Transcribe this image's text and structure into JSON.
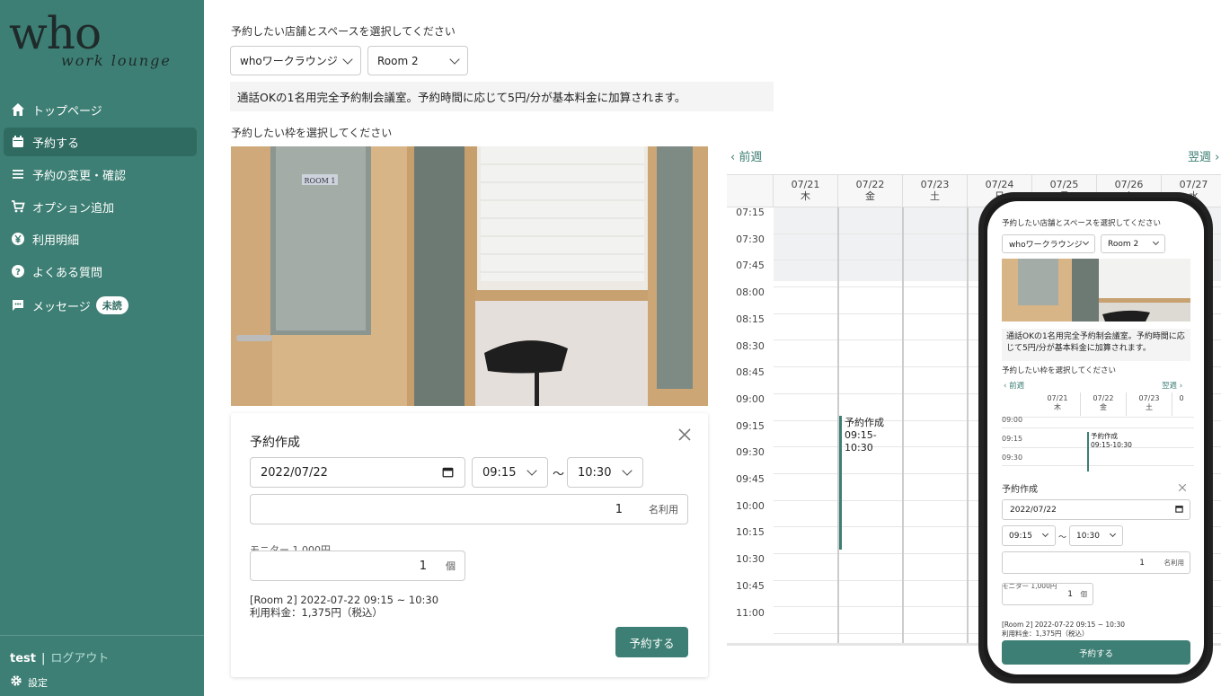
{
  "sidebar": {
    "logo_main": "who",
    "logo_sub": "work lounge",
    "items": [
      {
        "label": "トップページ",
        "icon": "home-icon"
      },
      {
        "label": "予約する",
        "icon": "calendar-icon",
        "active": true
      },
      {
        "label": "予約の変更・確認",
        "icon": "list-icon"
      },
      {
        "label": "オプション追加",
        "icon": "cart-icon"
      },
      {
        "label": "利用明細",
        "icon": "yen-icon"
      },
      {
        "label": "よくある質問",
        "icon": "question-icon"
      },
      {
        "label": "メッセージ",
        "icon": "message-icon",
        "badge": "未読"
      }
    ],
    "user": "test",
    "separator": "|",
    "logout": "ログアウト",
    "settings": "設定"
  },
  "main": {
    "select_prompt": "予約したい店舗とスペースを選択してください",
    "store_select": "whoワークラウンジ",
    "room_select": "Room 2",
    "room_note": "通話OKの1名用完全予約制会議室。予約時間に応じて5円/分が基本料金に加算されます。",
    "slot_prompt": "予約したい枠を選択してください",
    "photo_sign": "ROOM 1"
  },
  "form": {
    "title": "予約作成",
    "date": "2022/07/22",
    "start": "09:15",
    "tilde": "〜",
    "end": "10:30",
    "people": "1",
    "people_suffix": "名利用",
    "option_label": "モニター 1,000円",
    "option_qty": "1",
    "option_suffix": "個",
    "summary_line1": "[Room 2] 2022-07-22 09:15 ~ 10:30",
    "summary_line2": "利用料金：1,375円（税込）",
    "submit": "予約する"
  },
  "calendar": {
    "prev": "前週",
    "next": "翌週",
    "days": [
      {
        "date": "07/21",
        "dow": "木"
      },
      {
        "date": "07/22",
        "dow": "金"
      },
      {
        "date": "07/23",
        "dow": "土"
      },
      {
        "date": "07/24",
        "dow": "日"
      },
      {
        "date": "07/25",
        "dow": "月"
      },
      {
        "date": "07/26",
        "dow": "火"
      },
      {
        "date": "07/27",
        "dow": "水"
      }
    ],
    "times": [
      "07:15",
      "07:30",
      "07:45",
      "08:00",
      "08:15",
      "08:30",
      "08:45",
      "09:00",
      "09:15",
      "09:30",
      "09:45",
      "10:00",
      "10:15",
      "10:30",
      "10:45",
      "11:00"
    ],
    "event_title": "予約作成",
    "event_time": "09:15-10:30"
  },
  "phone": {
    "select_prompt": "予約したい店舗とスペースを選択してください",
    "store_select": "whoワークラウンジ",
    "room_select": "Room 2",
    "note": "通話OKの1名用完全予約制会議室。予約時間に応じて5円/分が基本料金に加算されます。",
    "slot_prompt": "予約したい枠を選択してください",
    "prev": "前週",
    "next": "翌週",
    "days": [
      {
        "date": "07/21",
        "dow": "木"
      },
      {
        "date": "07/22",
        "dow": "金"
      },
      {
        "date": "07/23",
        "dow": "土"
      },
      {
        "date": "0",
        "dow": ""
      }
    ],
    "times": [
      "09:00",
      "09:15",
      "09:30"
    ],
    "event_title": "予約作成",
    "event_time": "09:15-10:30",
    "form_title": "予約作成",
    "date": "2022/07/22",
    "start": "09:15",
    "tilde": "〜",
    "end": "10:30",
    "people": "1",
    "people_suffix": "名利用",
    "option_label": "モニター 1,000円",
    "option_qty": "1",
    "option_suffix": "個",
    "summary_line1": "[Room 2] 2022-07-22 09:15 ~ 10:30",
    "summary_line2": "利用料金：1,375円（税込）",
    "submit": "予約する"
  },
  "colors": {
    "brand": "#3d7f74",
    "brand_dark": "#2f6b61"
  }
}
